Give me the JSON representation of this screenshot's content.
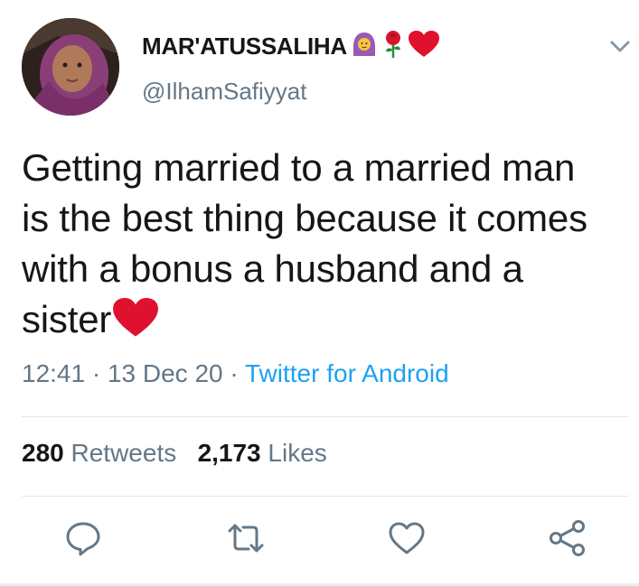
{
  "user": {
    "display_name": "MAR'ATUSSALIHA",
    "name_emojis": [
      "person-with-headscarf-emoji",
      "rose-emoji",
      "red-heart-emoji"
    ],
    "handle": "@IlhamSafiyyat"
  },
  "tweet": {
    "text_line_1": "Getting married to a married man",
    "text_line_2": "is the best thing because it comes",
    "text_line_3": "with a bonus a husband and a",
    "text_line_4": "sister",
    "time": "12:41",
    "separator": "·",
    "date": "13 Dec 20",
    "source": "Twitter for Android"
  },
  "stats": {
    "retweets_count": "280",
    "retweets_label": "Retweets",
    "likes_count": "2,173",
    "likes_label": "Likes"
  },
  "actions": {
    "icons": [
      "reply-icon",
      "retweet-icon",
      "like-icon",
      "share-icon"
    ]
  },
  "colors": {
    "text": "#14171a",
    "secondary": "#657786",
    "link": "#1da1f2",
    "divider": "#e1e8ed",
    "heart": "#e0245e"
  }
}
